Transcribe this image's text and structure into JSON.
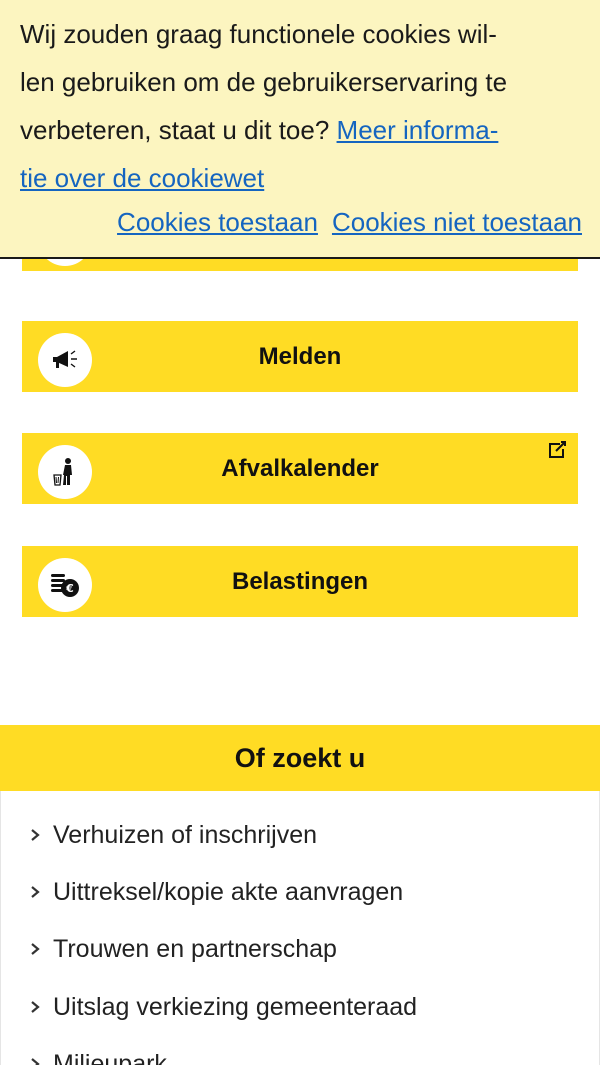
{
  "cookie_banner": {
    "text": "Wij zouden graag functionele cookies wil-len gebruiken om de gebruikerservaring te verbeteren, staat u dit toe?",
    "text_line1": "Wij zouden graag functionele cookies wil-",
    "text_line2": "len gebruiken om de gebruikerservaring te",
    "text_line3": "verbeteren, staat u dit toe? ",
    "info_link_part1": "Meer informa-",
    "info_link_part2": "tie over de cookiewet",
    "accept_label": "Cookies toestaan",
    "decline_label": "Cookies niet toestaan"
  },
  "tiles": [
    {
      "label": "Melden",
      "icon": "megaphone-icon"
    },
    {
      "label": "Afvalkalender",
      "icon": "trash-person-icon",
      "external": "external-link-icon"
    },
    {
      "label": "Belastingen",
      "icon": "coins-euro-icon"
    }
  ],
  "zoek": {
    "title": "Of zoekt u",
    "items": [
      "Verhuizen of inschrijven",
      "Uittreksel/kopie akte aanvragen",
      "Trouwen en partnerschap",
      "Uitslag verkiezing gemeenteraad",
      "Milieupark"
    ]
  },
  "colors": {
    "tile_yellow": "#ffdc24",
    "banner_bg": "#fcf5c0",
    "link_blue": "#1565c0"
  }
}
